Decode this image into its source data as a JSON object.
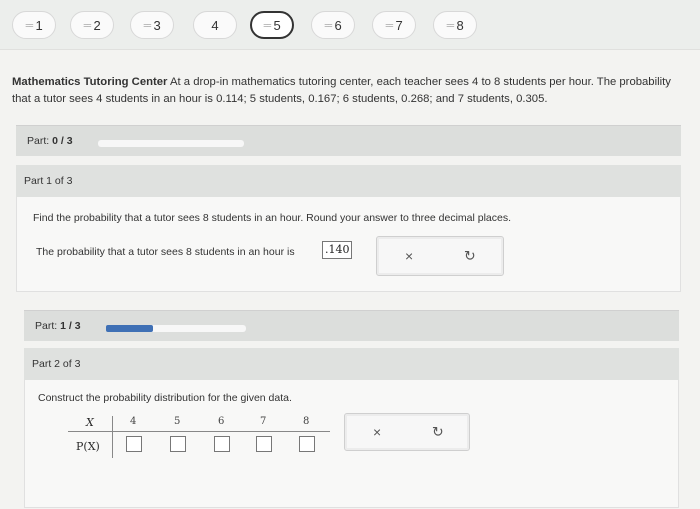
{
  "nav": {
    "questions": [
      {
        "label": "1",
        "active": false
      },
      {
        "label": "2",
        "active": false
      },
      {
        "label": "3",
        "active": false
      },
      {
        "label": "4",
        "active": false
      },
      {
        "label": "5",
        "active": true
      },
      {
        "label": "6",
        "active": false
      },
      {
        "label": "7",
        "active": false
      },
      {
        "label": "8",
        "active": false
      }
    ]
  },
  "problem": {
    "title": "Mathematics Tutoring Center",
    "text": "At a drop-in mathematics tutoring center, each teacher sees 4 to 8 students per hour. The probability that a tutor sees 4 students in an hour is 0.114; 5 students, 0.167; 6 students, 0.268; and 7 students, 0.305."
  },
  "overall_progress": {
    "label": "Part:",
    "value": "0 / 3",
    "fraction": 0.0
  },
  "part1": {
    "header": "Part 1 of 3",
    "question": "Find the probability that a tutor sees 8 students in an hour. Round your answer to three decimal places.",
    "answer_prefix": "The probability that a tutor sees 8 students in an hour is",
    "answer_value": ".140",
    "clear_glyph": "×",
    "retry_glyph": "↻"
  },
  "part_progress": {
    "label": "Part:",
    "value": "1 / 3",
    "fraction": 0.333
  },
  "part2": {
    "header": "Part 2 of 3",
    "question": "Construct the probability distribution for the given data.",
    "x_header": "X",
    "p_header": "P(X)",
    "x_values": [
      "4",
      "5",
      "6",
      "7",
      "8"
    ],
    "clear_glyph": "×",
    "retry_glyph": "↻"
  },
  "colors": {
    "accent": "#3f70b5",
    "background": "#f3f3f1",
    "partbar": "#dcdedc"
  }
}
